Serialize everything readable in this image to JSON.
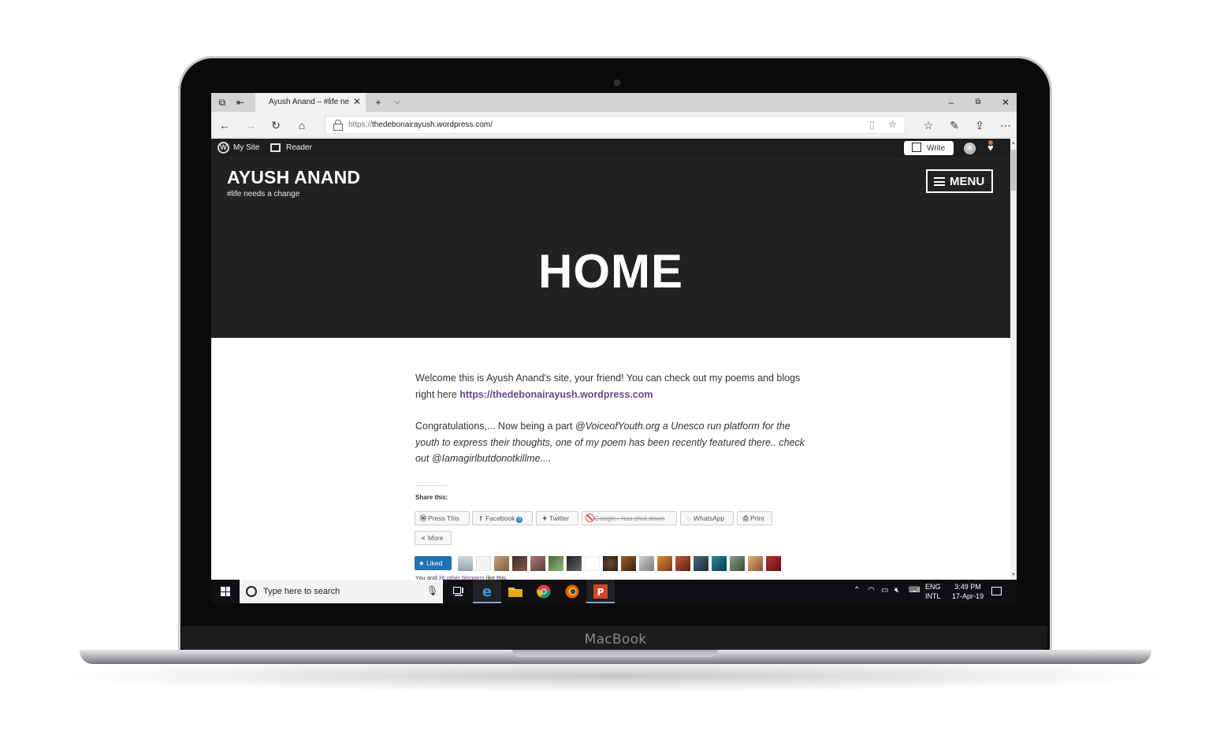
{
  "device": {
    "brand": "MacBook"
  },
  "browser": {
    "tab_title": "Ayush Anand – #life nee",
    "url_protocol": "https://",
    "url_host": "thedebonairayush.wordpress.com/",
    "new_tab_icon": "plus-icon",
    "accent": "#d3d3d3"
  },
  "wp_admin_bar": {
    "my_site": "My Site",
    "reader": "Reader",
    "write": "Write"
  },
  "site": {
    "title": "AYUSH ANAND",
    "tagline": "#life needs a change",
    "menu_label": "MENU",
    "page_title": "HOME",
    "header_bg": "#222222",
    "link_color": "#674a86"
  },
  "content": {
    "p1_text": "Welcome this is Ayush Anand's site, your friend! You can check out my poems and blogs right here ",
    "p1_link": "https://thedebonairayush.wordpress.com",
    "p2_plain": "Congratulations,... Now being a part ",
    "p2_italic": "@VoiceofYouth.org a Unesco run platform for the youth to express their thoughts, one of my poem has been recently featured there.. check out @Iamagirlbutdonotkillme....",
    "share_title": "Share this:",
    "share_buttons": {
      "press_this": "Press This",
      "facebook": "Facebook",
      "facebook_count": "0",
      "twitter": "Twitter",
      "google": "Google+ has shut down",
      "whatsapp": "WhatsApp",
      "print": "Print",
      "more": "More"
    },
    "liked_label": "Liked",
    "likes_prefix": "You and ",
    "likes_link": "36 other bloggers",
    "likes_suffix": " like this."
  },
  "taskbar": {
    "search_placeholder": "Type here to search",
    "lang_1": "ENG",
    "lang_2": "INTL",
    "time": "3:49 PM",
    "date": "17-Apr-19"
  }
}
